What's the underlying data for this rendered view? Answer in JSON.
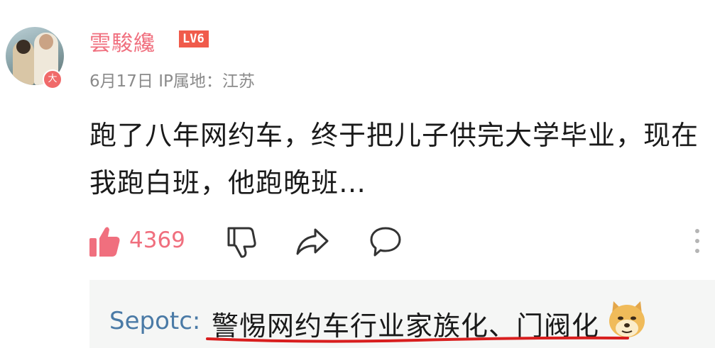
{
  "user": {
    "name": "雲駿纔",
    "level": "LV6",
    "avatar_badge": "大"
  },
  "comment": {
    "date": "6月17日",
    "ip_location": "IP属地：江苏",
    "text": "跑了八年网约车，终于把儿子供完大学毕业，现在我跑白班，他跑晚班…",
    "like_count": "4369"
  },
  "icons": {
    "like": "thumbs-up-filled-icon",
    "dislike": "thumbs-down-icon",
    "share": "share-arrow-icon",
    "reply": "chat-bubble-icon",
    "more": "more-vertical-icon",
    "emoji": "doge-emoji-icon"
  },
  "reply": {
    "author": "Sepotc:",
    "text": "警惕网约车行业家族化、门阀化"
  },
  "colors": {
    "accent": "#f06f7e",
    "level_badge": "#f05b4b",
    "reply_author": "#4a7aa6",
    "underline": "#d81e1e"
  }
}
